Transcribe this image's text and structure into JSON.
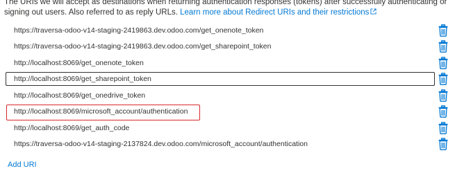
{
  "description": {
    "text": "The URIs we will accept as destinations when returning authentication responses (tokens) after successfully authenticating or signing out users. Also referred to as reply URLs.",
    "link_text": "Learn more about Redirect URIs and their restrictions",
    "link_icon": "external-link-icon"
  },
  "redirect_uris": [
    "https://traversa-odoo-v14-staging-2419863.dev.odoo.com/get_onenote_token",
    "https://traversa-odoo-v14-staging-2419863.dev.odoo.com/get_sharepoint_token",
    "http://localhost:8069/get_onenote_token",
    "http://localhost:8069/get_sharepoint_token",
    "http://localhost:8069/get_onedrive_token",
    "http://localhost:8069/microsoft_account/authentication",
    "http://localhost:8069/get_auth_code",
    "https://traversa-odoo-v14-staging-2137824.dev.odoo.com/microsoft_account/authentication"
  ],
  "focused_index": 3,
  "highlighted_index": 5,
  "delete_icon": "trash-icon",
  "add_uri_label": "Add URI",
  "colors": {
    "link": "#0078d4",
    "highlight": "#d9262b",
    "text": "#323130"
  }
}
